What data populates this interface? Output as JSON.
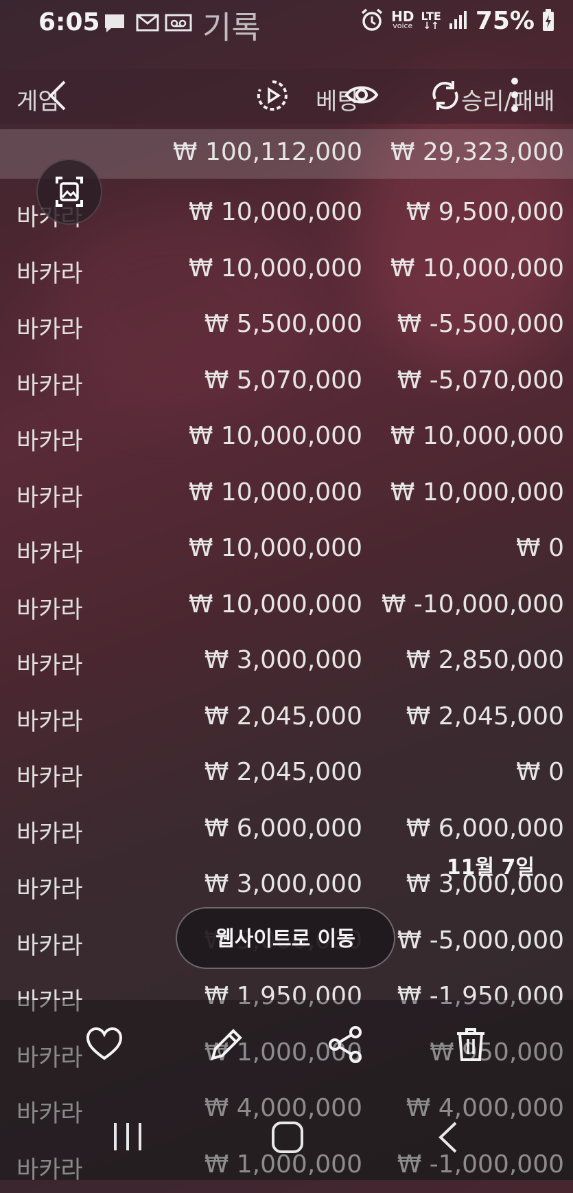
{
  "status_bar": {
    "time": "6:05",
    "title": "기록",
    "network": {
      "hd": "HD",
      "voice": "voice",
      "lte": "LTE"
    },
    "battery": "75%"
  },
  "header": {
    "col_game": "게임",
    "col_bet": "베팅",
    "col_result": "승리/패배"
  },
  "totals": {
    "bet": "₩ 100,112,000",
    "result": "₩ 29,323,000"
  },
  "rows": [
    {
      "game": "바카라",
      "bet": "₩ 10,000,000",
      "result": "₩ 9,500,000"
    },
    {
      "game": "바카라",
      "bet": "₩ 10,000,000",
      "result": "₩ 10,000,000"
    },
    {
      "game": "바카라",
      "bet": "₩ 5,500,000",
      "result": "₩ -5,500,000"
    },
    {
      "game": "바카라",
      "bet": "₩ 5,070,000",
      "result": "₩ -5,070,000"
    },
    {
      "game": "바카라",
      "bet": "₩ 10,000,000",
      "result": "₩ 10,000,000"
    },
    {
      "game": "바카라",
      "bet": "₩ 10,000,000",
      "result": "₩ 10,000,000"
    },
    {
      "game": "바카라",
      "bet": "₩ 10,000,000",
      "result": "₩ 0"
    },
    {
      "game": "바카라",
      "bet": "₩ 10,000,000",
      "result": "₩ -10,000,000"
    },
    {
      "game": "바카라",
      "bet": "₩ 3,000,000",
      "result": "₩ 2,850,000"
    },
    {
      "game": "바카라",
      "bet": "₩ 2,045,000",
      "result": "₩ 2,045,000"
    },
    {
      "game": "바카라",
      "bet": "₩ 2,045,000",
      "result": "₩ 0"
    },
    {
      "game": "바카라",
      "bet": "₩ 6,000,000",
      "result": "₩ 6,000,000"
    },
    {
      "game": "바카라",
      "bet": "₩ 3,000,000",
      "result": "₩ 3,000,000"
    },
    {
      "game": "바카라",
      "bet": "₩ 5,000,000",
      "result": "₩ -5,000,000"
    },
    {
      "game": "바카라",
      "bet": "₩ 1,950,000",
      "result": "₩ -1,950,000"
    },
    {
      "game": "바카라",
      "bet": "₩ 1,000,000",
      "result": "₩ 950,000"
    },
    {
      "game": "바카라",
      "bet": "₩ 4,000,000",
      "result": "₩ 4,000,000"
    },
    {
      "game": "바카라",
      "bet": "₩ 1,000,000",
      "result": "₩ -1,000,000"
    }
  ],
  "gallery": {
    "date": "11월 7일",
    "go_to_website": "웹사이트로 이동",
    "actions": [
      "heart-icon",
      "edit-icon",
      "share-icon",
      "trash-icon"
    ]
  },
  "nav_bar": [
    "recents-icon",
    "home-icon",
    "back-icon"
  ]
}
